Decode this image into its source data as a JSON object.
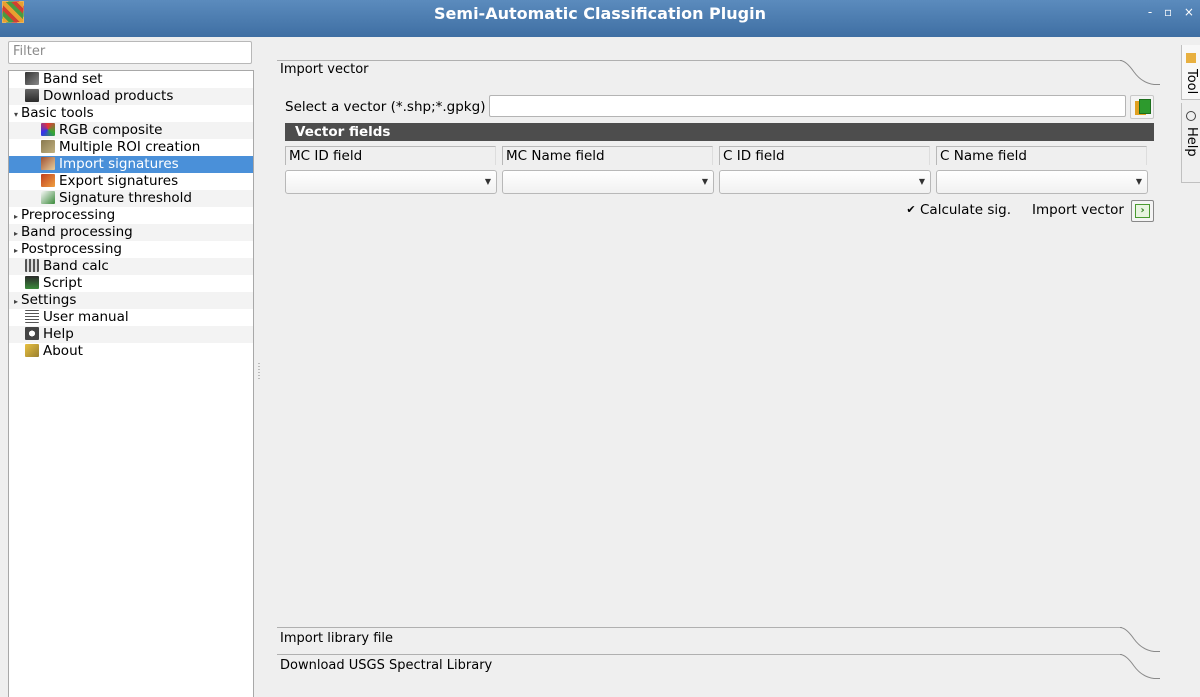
{
  "window": {
    "title": "Semi-Automatic Classification Plugin",
    "controls": "- ▫ ×"
  },
  "sidebar": {
    "filter_placeholder": "Filter",
    "items": [
      {
        "label": "Band set",
        "icon": "band-set-icon",
        "level": 0,
        "expander": "",
        "selected": false
      },
      {
        "label": "Download products",
        "icon": "download-icon",
        "level": 0,
        "expander": "",
        "selected": false
      },
      {
        "label": "Basic tools",
        "icon": "",
        "level": 0,
        "expander": "▾",
        "selected": false
      },
      {
        "label": "RGB composite",
        "icon": "rgb-composite-icon",
        "level": 1,
        "expander": "",
        "selected": false
      },
      {
        "label": "Multiple ROI creation",
        "icon": "roi-creation-icon",
        "level": 1,
        "expander": "",
        "selected": false
      },
      {
        "label": "Import signatures",
        "icon": "import-signatures-icon",
        "level": 1,
        "expander": "",
        "selected": true
      },
      {
        "label": "Export signatures",
        "icon": "export-signatures-icon",
        "level": 1,
        "expander": "",
        "selected": false
      },
      {
        "label": "Signature threshold",
        "icon": "signature-threshold-icon",
        "level": 1,
        "expander": "",
        "selected": false
      },
      {
        "label": "Preprocessing",
        "icon": "",
        "level": 0,
        "expander": "▸",
        "selected": false
      },
      {
        "label": "Band processing",
        "icon": "",
        "level": 0,
        "expander": "▸",
        "selected": false
      },
      {
        "label": "Postprocessing",
        "icon": "",
        "level": 0,
        "expander": "▸",
        "selected": false
      },
      {
        "label": "Band calc",
        "icon": "band-calc-icon",
        "level": 0,
        "expander": "",
        "selected": false
      },
      {
        "label": "Script",
        "icon": "script-icon",
        "level": 0,
        "expander": "",
        "selected": false
      },
      {
        "label": "Settings",
        "icon": "",
        "level": 0,
        "expander": "▸",
        "selected": false
      },
      {
        "label": "User manual",
        "icon": "user-manual-icon",
        "level": 0,
        "expander": "",
        "selected": false
      },
      {
        "label": "Help",
        "icon": "help-icon",
        "level": 0,
        "expander": "",
        "selected": false
      },
      {
        "label": "About",
        "icon": "about-icon",
        "level": 0,
        "expander": "",
        "selected": false
      }
    ]
  },
  "main": {
    "import_vector_tab": "Import vector",
    "select_vector_label": "Select a vector (*.shp;*.gpkg)",
    "vector_path_value": "",
    "vector_fields_header": "Vector fields",
    "fields": [
      {
        "label": "MC ID field",
        "value": ""
      },
      {
        "label": "MC Name field",
        "value": ""
      },
      {
        "label": "C ID field",
        "value": ""
      },
      {
        "label": "C Name field",
        "value": ""
      }
    ],
    "calculate_sig_label": "Calculate sig.",
    "calculate_sig_checked": "✔",
    "import_vector_button_label": "Import vector",
    "import_library_tab": "Import library file",
    "download_usgs_tab": "Download USGS Spectral Library"
  },
  "right_dock": {
    "tabs": [
      {
        "label": "Tool",
        "icon": "tool-icon"
      },
      {
        "label": "Help",
        "icon": "help-icon"
      }
    ]
  }
}
